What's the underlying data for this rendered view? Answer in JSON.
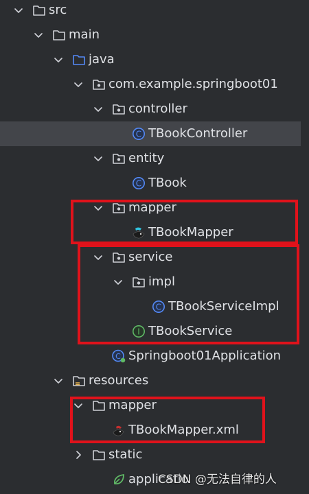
{
  "tree": [
    {
      "key": "src",
      "label": "src",
      "depth": 0,
      "expanded": true,
      "icon": "folder-icon"
    },
    {
      "key": "main",
      "label": "main",
      "depth": 1,
      "expanded": true,
      "icon": "folder-icon"
    },
    {
      "key": "java",
      "label": "java",
      "depth": 2,
      "expanded": true,
      "icon": "source-folder-icon"
    },
    {
      "key": "package_root",
      "label": "com.example.springboot01",
      "depth": 3,
      "expanded": true,
      "icon": "package-icon"
    },
    {
      "key": "controller",
      "label": "controller",
      "depth": 4,
      "expanded": true,
      "icon": "package-icon"
    },
    {
      "key": "tbookcontroller",
      "label": "TBookController",
      "depth": 5,
      "expanded": null,
      "icon": "class-icon",
      "selected": true
    },
    {
      "key": "entity",
      "label": "entity",
      "depth": 4,
      "expanded": true,
      "icon": "package-icon"
    },
    {
      "key": "tbook",
      "label": "TBook",
      "depth": 5,
      "expanded": null,
      "icon": "class-icon"
    },
    {
      "key": "mapper",
      "label": "mapper",
      "depth": 4,
      "expanded": true,
      "icon": "package-icon"
    },
    {
      "key": "tbookmapper",
      "label": "TBookMapper",
      "depth": 5,
      "expanded": null,
      "icon": "mybatis-icon"
    },
    {
      "key": "service",
      "label": "service",
      "depth": 4,
      "expanded": true,
      "icon": "package-icon"
    },
    {
      "key": "impl",
      "label": "impl",
      "depth": 5,
      "expanded": true,
      "icon": "package-icon"
    },
    {
      "key": "tbookserviceimpl",
      "label": "TBookServiceImpl",
      "depth": 6,
      "expanded": null,
      "icon": "class-icon"
    },
    {
      "key": "tbookservice",
      "label": "TBookService",
      "depth": 5,
      "expanded": null,
      "icon": "interface-icon"
    },
    {
      "key": "springboot01application",
      "label": "Springboot01Application",
      "depth": 4,
      "expanded": null,
      "icon": "spring-class-icon"
    },
    {
      "key": "resources",
      "label": "resources",
      "depth": 2,
      "expanded": true,
      "icon": "resources-folder-icon"
    },
    {
      "key": "res_mapper",
      "label": "mapper",
      "depth": 3,
      "expanded": true,
      "icon": "folder-icon"
    },
    {
      "key": "tbookmapper_xml",
      "label": "TBookMapper.xml",
      "depth": 4,
      "expanded": null,
      "icon": "mybatis-xml-icon"
    },
    {
      "key": "static",
      "label": "static",
      "depth": 3,
      "expanded": false,
      "icon": "folder-icon"
    },
    {
      "key": "application_yml",
      "label": "applicatio",
      "depth": 4,
      "expanded": null,
      "icon": "spring-config-icon"
    }
  ],
  "watermark": "CSDN @无法自律的人",
  "colors": {
    "background": "#2b2d30",
    "selection": "#43454a",
    "text": "#dfe1e5",
    "highlight_box": "#e0121b",
    "class_icon": "#548af7",
    "interface_icon": "#5fb865"
  }
}
